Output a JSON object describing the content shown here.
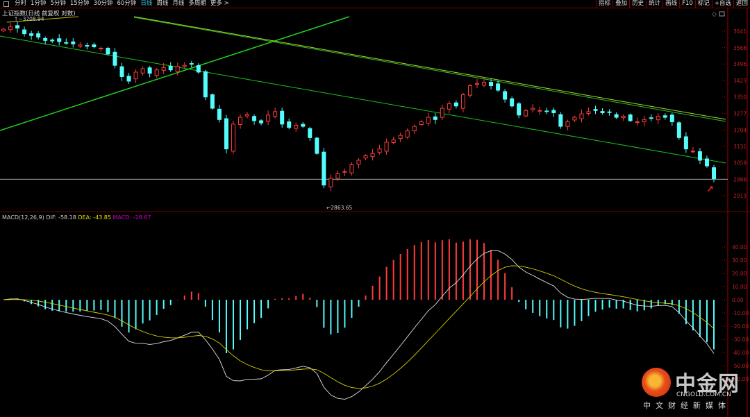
{
  "toolbar": {
    "left": [
      "分时",
      "1分钟",
      "5分钟",
      "15分钟",
      "30分钟",
      "60分钟",
      "日线",
      "周线",
      "月线",
      "多周期",
      "更多 >"
    ],
    "active": "日线",
    "right": [
      "指标",
      "叠加",
      "历史",
      "统计",
      "画线",
      "F10",
      "标记",
      "+自选",
      "返回"
    ]
  },
  "chart_title": "上证指数(日线 前复权 对数)",
  "annotations": {
    "high": "3708.94",
    "low": "2863.65"
  },
  "macd_header": {
    "name": "MACD(12,26,9)",
    "dif": "DIF: -58.18",
    "dea": "DEA: -43.85",
    "macd": "MACD: -28.67"
  },
  "watermark": {
    "name": "中金网",
    "url": "CNGOLD.COM.CN",
    "tagline": "中文财经新媒体"
  },
  "colors": {
    "up": "#ff3c3c",
    "down": "#54fcfc",
    "axis": "#c02020",
    "dif": "#e0e0e0",
    "dea": "#d8d000"
  },
  "chart_data": {
    "type": "candlestick",
    "price_ticks": [
      3641,
      3568,
      3496,
      3423,
      3350,
      3277,
      3204,
      3131,
      3059,
      2986,
      2913
    ],
    "macd_ticks": [
      "40.00",
      "30.00",
      "20.00",
      "10.00",
      "0.00",
      "-10.00",
      "-20.00",
      "-30.00",
      "-40.00",
      "-50.00",
      "-60.00"
    ],
    "reference_line": 2986,
    "closes": [
      3650,
      3660,
      3655,
      3630,
      3622,
      3615,
      3600,
      3598,
      3595,
      3590,
      3585,
      3580,
      3575,
      3572,
      3566,
      3540,
      3490,
      3440,
      3420,
      3460,
      3475,
      3455,
      3470,
      3480,
      3470,
      3485,
      3490,
      3495,
      3460,
      3350,
      3300,
      3250,
      3120,
      3230,
      3260,
      3272,
      3245,
      3235,
      3270,
      3285,
      3230,
      3215,
      3225,
      3220,
      3170,
      3100,
      2960,
      2990,
      3010,
      3020,
      3050,
      3070,
      3090,
      3100,
      3120,
      3150,
      3160,
      3180,
      3200,
      3220,
      3240,
      3260,
      3250,
      3300,
      3320,
      3310,
      3360,
      3400,
      3410,
      3415,
      3400,
      3380,
      3340,
      3310,
      3270,
      3290,
      3300,
      3290,
      3285,
      3280,
      3220,
      3240,
      3260,
      3275,
      3285,
      3290,
      3280,
      3282,
      3260,
      3265,
      3245,
      3240,
      3250,
      3255,
      3265,
      3260,
      3240,
      3170,
      3120,
      3110,
      3070,
      3045,
      2988
    ]
  }
}
